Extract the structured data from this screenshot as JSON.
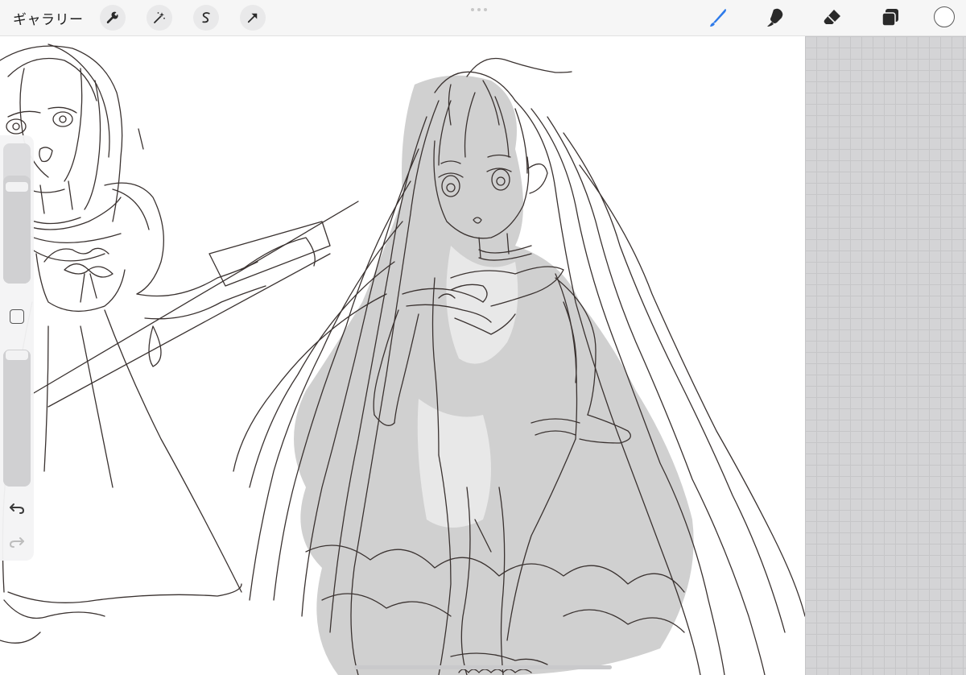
{
  "topbar": {
    "gallery_label": "ギャラリー",
    "left_tools": [
      {
        "name": "actions",
        "icon": "wrench-icon"
      },
      {
        "name": "adjustments",
        "icon": "magic-wand-icon"
      },
      {
        "name": "selection",
        "icon": "selection-s-icon"
      },
      {
        "name": "transform",
        "icon": "arrow-cursor-icon"
      }
    ],
    "right_tools": [
      {
        "name": "brush",
        "icon": "brush-icon",
        "active": true
      },
      {
        "name": "smudge",
        "icon": "smudge-icon"
      },
      {
        "name": "eraser",
        "icon": "eraser-icon"
      },
      {
        "name": "layers",
        "icon": "layers-icon"
      }
    ],
    "active_color": "#ffffff",
    "accent_color": "#2e7bea"
  },
  "sidebar": {
    "brush_size_level": 0.77,
    "opacity_level": 1.0,
    "modify_icon": "square-modify-icon",
    "undo_icon": "undo-icon",
    "redo_icon": "redo-icon"
  },
  "canvas": {
    "background_color": "#ffffff",
    "stroke_color": "#3a3230",
    "shade_color": "#c9c9c9",
    "grid_color": "#d4d4d6"
  }
}
